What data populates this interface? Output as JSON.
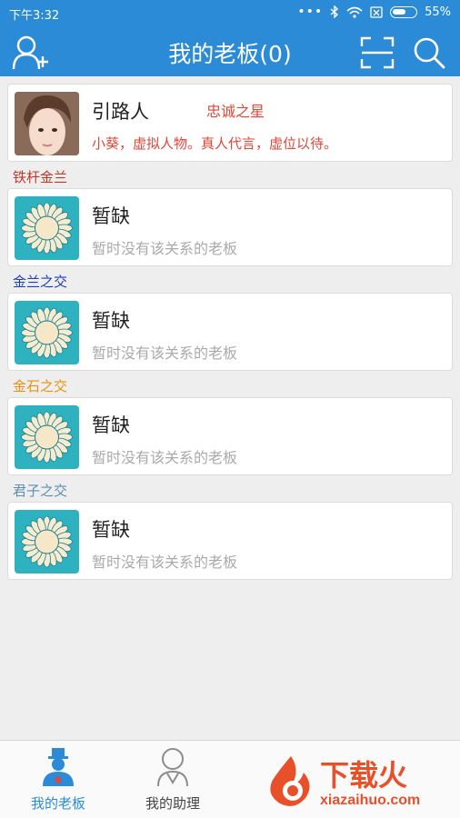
{
  "status": {
    "time": "下午3:32",
    "battery": "55%"
  },
  "header": {
    "title": "我的老板(0)",
    "icons": [
      "add-person-icon",
      "scan-icon",
      "search-icon"
    ]
  },
  "guide": {
    "name": "引路人",
    "badge": "忠诚之星",
    "description": "小葵，虚拟人物。真人代言，虚位以待。"
  },
  "sections": [
    {
      "label": "铁杆金兰",
      "color": "#c0392b",
      "name": "暂缺",
      "sub": "暂时没有该关系的老板"
    },
    {
      "label": "金兰之交",
      "color": "#1f3fb0",
      "name": "暂缺",
      "sub": "暂时没有该关系的老板"
    },
    {
      "label": "金石之交",
      "color": "#e8920c",
      "name": "暂缺",
      "sub": "暂时没有该关系的老板"
    },
    {
      "label": "君子之交",
      "color": "#5b8fb0",
      "name": "暂缺",
      "sub": "暂时没有该关系的老板"
    }
  ],
  "tabs": [
    {
      "label": "我的老板",
      "active": true,
      "icon": "boss-icon"
    },
    {
      "label": "我的助理",
      "active": false,
      "icon": "assistant-icon"
    }
  ],
  "watermark": {
    "title": "下载火",
    "url": "xiazaihuo.com"
  },
  "colors": {
    "primary": "#2b8bd6",
    "accent_red": "#e0463a",
    "avatar_bg": "#2fb2c0"
  }
}
